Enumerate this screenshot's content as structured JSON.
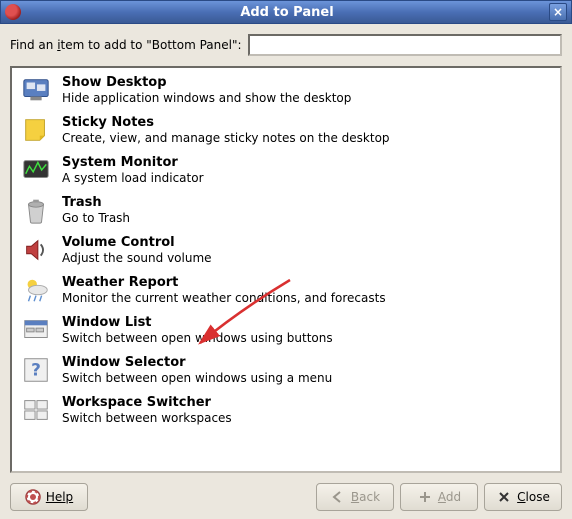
{
  "window": {
    "title": "Add to Panel"
  },
  "search": {
    "label_pre": "Find an ",
    "label_u": "i",
    "label_post": "tem to add to \"Bottom Panel\":",
    "value": ""
  },
  "items": [
    {
      "icon": "show-desktop",
      "title": "Show Desktop",
      "desc": "Hide application windows and show the desktop"
    },
    {
      "icon": "sticky-notes",
      "title": "Sticky Notes",
      "desc": "Create, view, and manage sticky notes on the desktop"
    },
    {
      "icon": "system-monitor",
      "title": "System Monitor",
      "desc": "A system load indicator"
    },
    {
      "icon": "trash",
      "title": "Trash",
      "desc": "Go to Trash"
    },
    {
      "icon": "volume",
      "title": "Volume Control",
      "desc": "Adjust the sound volume"
    },
    {
      "icon": "weather",
      "title": "Weather Report",
      "desc": "Monitor the current weather conditions, and forecasts"
    },
    {
      "icon": "window-list",
      "title": "Window List",
      "desc": "Switch between open windows using buttons"
    },
    {
      "icon": "window-selector",
      "title": "Window Selector",
      "desc": "Switch between open windows using a menu"
    },
    {
      "icon": "workspace-switcher",
      "title": "Workspace Switcher",
      "desc": "Switch between workspaces"
    }
  ],
  "buttons": {
    "help": "Help",
    "back": "Back",
    "add": "Add",
    "close": "Close"
  }
}
